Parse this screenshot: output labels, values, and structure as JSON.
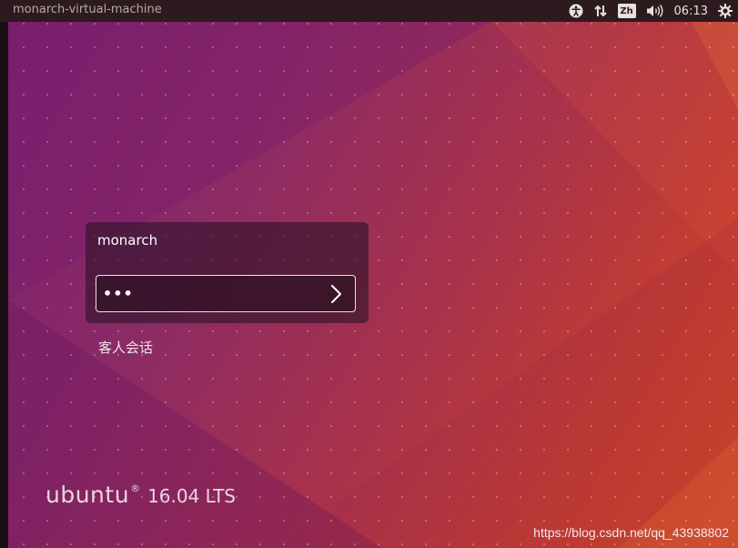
{
  "topbar": {
    "hostname": "monarch-virtual-machine",
    "input_method": "Zh",
    "time": "06:13",
    "icons": [
      "accessibility-icon",
      "network-icon",
      "input-method-icon",
      "volume-icon",
      "power-settings-icon"
    ]
  },
  "login": {
    "username": "monarch",
    "password_mask": "•••",
    "submit_icon": "chevron-right-icon"
  },
  "guest_session_label": "客人会话",
  "branding": {
    "name": "ubuntu",
    "registered_mark": "®",
    "version": "16.04 LTS"
  },
  "watermark": "https://blog.csdn.net/qq_43938802",
  "colors": {
    "topbar_bg": "#2d1a1f",
    "wallpaper_start": "#7a1f6f",
    "wallpaper_end": "#cf4b24"
  }
}
